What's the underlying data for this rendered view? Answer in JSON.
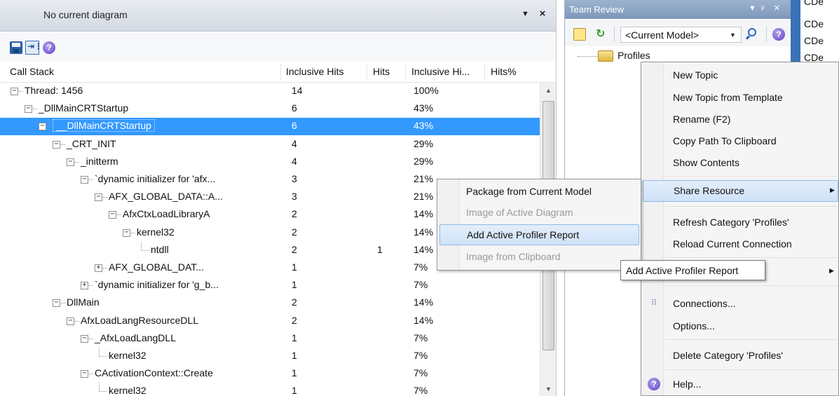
{
  "profiler": {
    "title": "No current diagram",
    "dropdown_glyph": "▼",
    "close_glyph": "×",
    "toolbar": {
      "save_icon": "save-icon",
      "tree_icon": "tree-view-icon",
      "help_icon": "help-icon",
      "tree_glyph": "⇥⋮",
      "help_glyph": "?"
    },
    "columns": [
      "Call Stack",
      "Inclusive Hits",
      "Hits",
      "Inclusive Hi...",
      "Hits%"
    ],
    "rows": [
      {
        "name": "Thread: 1456",
        "level": 0,
        "expander": "−",
        "inclusive_hits": "14",
        "hits": "",
        "inclusive_pct": "100%",
        "hits_pct": "",
        "selected": false
      },
      {
        "name": "_DllMainCRTStartup",
        "level": 1,
        "expander": "−",
        "inclusive_hits": "6",
        "hits": "",
        "inclusive_pct": "43%",
        "hits_pct": "",
        "selected": false
      },
      {
        "name": "__DllMainCRTStartup",
        "level": 2,
        "expander": "−",
        "inclusive_hits": "6",
        "hits": "",
        "inclusive_pct": "43%",
        "hits_pct": "",
        "selected": true
      },
      {
        "name": "_CRT_INIT",
        "level": 3,
        "expander": "−",
        "inclusive_hits": "4",
        "hits": "",
        "inclusive_pct": "29%",
        "hits_pct": "",
        "selected": false
      },
      {
        "name": "_initterm",
        "level": 4,
        "expander": "−",
        "inclusive_hits": "4",
        "hits": "",
        "inclusive_pct": "29%",
        "hits_pct": "",
        "selected": false
      },
      {
        "name": "`dynamic initializer for 'afx...",
        "level": 5,
        "expander": "−",
        "inclusive_hits": "3",
        "hits": "",
        "inclusive_pct": "21%",
        "hits_pct": "",
        "selected": false
      },
      {
        "name": "AFX_GLOBAL_DATA::A...",
        "level": 6,
        "expander": "−",
        "inclusive_hits": "3",
        "hits": "",
        "inclusive_pct": "21%",
        "hits_pct": "",
        "selected": false
      },
      {
        "name": "AfxCtxLoadLibraryA",
        "level": 7,
        "expander": "−",
        "inclusive_hits": "2",
        "hits": "",
        "inclusive_pct": "14%",
        "hits_pct": "",
        "selected": false
      },
      {
        "name": "kernel32",
        "level": 8,
        "expander": "−",
        "inclusive_hits": "2",
        "hits": "",
        "inclusive_pct": "14%",
        "hits_pct": "",
        "selected": false
      },
      {
        "name": "ntdll",
        "level": 9,
        "expander": "",
        "inclusive_hits": "2",
        "hits": "1",
        "inclusive_pct": "14%",
        "hits_pct": "",
        "selected": false
      },
      {
        "name": "AFX_GLOBAL_DAT...",
        "level": 6,
        "expander": "+",
        "inclusive_hits": "1",
        "hits": "",
        "inclusive_pct": "7%",
        "hits_pct": "",
        "selected": false
      },
      {
        "name": "`dynamic initializer for 'g_b...",
        "level": 5,
        "expander": "+",
        "inclusive_hits": "1",
        "hits": "",
        "inclusive_pct": "7%",
        "hits_pct": "",
        "selected": false
      },
      {
        "name": "DllMain",
        "level": 3,
        "expander": "−",
        "inclusive_hits": "2",
        "hits": "",
        "inclusive_pct": "14%",
        "hits_pct": "",
        "selected": false
      },
      {
        "name": "AfxLoadLangResourceDLL",
        "level": 4,
        "expander": "−",
        "inclusive_hits": "2",
        "hits": "",
        "inclusive_pct": "14%",
        "hits_pct": "",
        "selected": false
      },
      {
        "name": "_AfxLoadLangDLL",
        "level": 5,
        "expander": "−",
        "inclusive_hits": "1",
        "hits": "",
        "inclusive_pct": "7%",
        "hits_pct": "",
        "selected": false
      },
      {
        "name": "kernel32",
        "level": 6,
        "expander": "",
        "inclusive_hits": "1",
        "hits": "",
        "inclusive_pct": "7%",
        "hits_pct": "",
        "selected": false
      },
      {
        "name": "CActivationContext::Create",
        "level": 5,
        "expander": "−",
        "inclusive_hits": "1",
        "hits": "",
        "inclusive_pct": "7%",
        "hits_pct": "",
        "selected": false
      },
      {
        "name": "kernel32",
        "level": 6,
        "expander": "",
        "inclusive_hits": "1",
        "hits": "",
        "inclusive_pct": "7%",
        "hits_pct": "",
        "selected": false
      }
    ],
    "scroll_up_glyph": "▲",
    "scroll_down_glyph": "▼"
  },
  "team_review": {
    "title": "Team Review",
    "title_dropdown_glyph": "▼",
    "pin_glyph": "ᵖ",
    "close_glyph": "×",
    "model_select_value": "<Current Model>",
    "model_select_caret": "▼",
    "refresh_glyph": "↻",
    "help_glyph": "?",
    "tree_root": "Profiles",
    "edge_items": [
      "CDe",
      "CDe",
      "CDe",
      "CDe"
    ]
  },
  "context_menu": {
    "items": [
      {
        "label": "New Topic"
      },
      {
        "label": "New Topic from Template"
      },
      {
        "label": "Rename (F2)"
      },
      {
        "label": "Copy Path To Clipboard"
      },
      {
        "label": "Show Contents"
      },
      {
        "label": "Share Resource",
        "submenu": true,
        "highlighted": true
      },
      {
        "label": "Refresh Category 'Profiles'"
      },
      {
        "label": "Reload Current Connection"
      },
      {
        "label": "",
        "submenu": true
      },
      {
        "label": "Connections..."
      },
      {
        "label": "Options..."
      },
      {
        "label": "Delete Category 'Profiles'"
      },
      {
        "label": "Help..."
      }
    ],
    "submenu_arrow": "▶",
    "connections_glyph": "⁝⁝",
    "help_glyph": "?"
  },
  "share_submenu": {
    "items": [
      {
        "label": "Package from Current Model",
        "disabled": false,
        "highlighted": false
      },
      {
        "label": "Image of Active Diagram",
        "disabled": true,
        "highlighted": false
      },
      {
        "label": "Add Active Profiler Report",
        "disabled": false,
        "highlighted": true
      },
      {
        "label": "Image from Clipboard",
        "disabled": true,
        "highlighted": false
      }
    ]
  },
  "tooltip": {
    "text": "Add Active Profiler Report"
  },
  "colors": {
    "selection": "#3399ff",
    "menu_highlight": "#cfe2f8",
    "disabled_text": "#9a9a9a"
  }
}
